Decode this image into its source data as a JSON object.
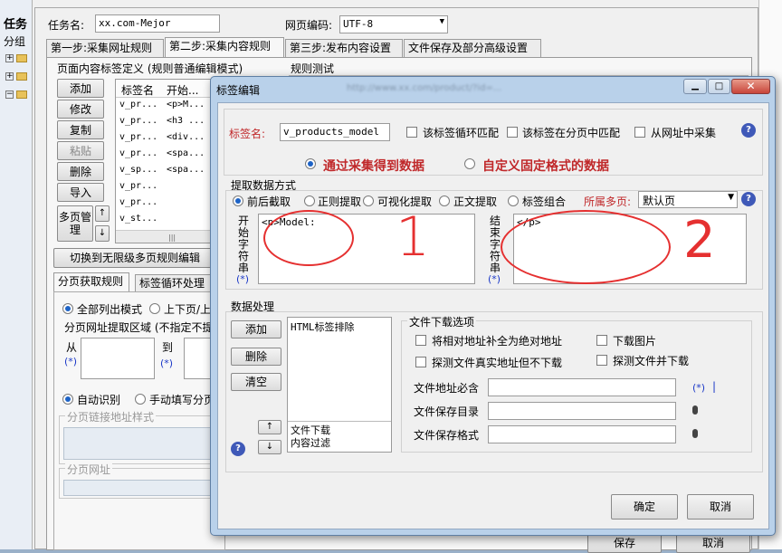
{
  "back": {
    "left_panel_title": "任务",
    "left_panel_group": "分组",
    "task_label": "任务名:",
    "task_value": "xx.com-Mejor",
    "encoding_label": "网页编码:",
    "encoding_value": "UTF-8",
    "tabs": [
      "第一步:采集网址规则",
      "第二步:采集内容规则",
      "第三步:发布内容设置",
      "文件保存及部分高级设置"
    ],
    "def_title": "页面内容标签定义 (规则普通编辑模式)",
    "test_title": "规则测试",
    "buttons": [
      "添加",
      "修改",
      "复制",
      "粘贴",
      "删除",
      "导入"
    ],
    "multipage_btn": "多页管理",
    "col_name": "标签名",
    "col_start": "开始...",
    "rows": [
      {
        "name": "v_pr...",
        "start": "<p>M..."
      },
      {
        "name": "v_pr...",
        "start": "<h3 ..."
      },
      {
        "name": "v_pr...",
        "start": "<div..."
      },
      {
        "name": "v_pr...",
        "start": "<spa..."
      },
      {
        "name": "v_sp...",
        "start": "<spa..."
      },
      {
        "name": "v_pr...",
        "start": ""
      },
      {
        "name": "v_pr...",
        "start": ""
      },
      {
        "name": "v_st...",
        "start": ""
      }
    ],
    "switch_btn": "切换到无限级多页规则编辑",
    "sub_tabs": [
      "分页获取规则",
      "标签循环处理"
    ],
    "list_all": "全部列出模式",
    "updown": "上下页/上",
    "page_area": "分页网址提取区域 (不指定不提",
    "from": "从",
    "to": "到",
    "star": "(*)",
    "auto": "自动识别",
    "manual": "手动填写分页",
    "link_style": "分页链接地址样式",
    "page_url": "分页网址",
    "save_btn": "保存",
    "cancel_btn": "取消"
  },
  "dialog": {
    "title": "标签编辑",
    "blurred_url": "http://www.xx.com/product/?id=...",
    "tag_name_label": "标签名:",
    "tag_name_value": "v_products_model",
    "chk_loop": "该标签循环匹配",
    "chk_paging": "该标签在分页中匹配",
    "chk_url": "从网址中采集",
    "opt_collect": "通过采集得到数据",
    "opt_custom": "自定义固定格式的数据",
    "extract_title": "提取数据方式",
    "methods": [
      "前后截取",
      "正则提取",
      "可视化提取",
      "正文提取",
      "标签组合"
    ],
    "belong_label": "所属多页:",
    "belong_value": "默认页",
    "start_label": "开始字符串",
    "start_value": "<p>Model:",
    "end_label": "结束字符串",
    "end_value": "</p>",
    "star": "(*)",
    "annotation_1": "1",
    "annotation_2": "2",
    "proc_title": "数据处理",
    "proc_add": "添加",
    "proc_del": "删除",
    "proc_clear": "清空",
    "proc_list": [
      "HTML标签排除"
    ],
    "proc_list_bottom": [
      "文件下载",
      "内容过滤"
    ],
    "dl_title": "文件下载选项",
    "dl_abs": "将相对地址补全为绝对地址",
    "dl_img": "下载图片",
    "dl_probe_no": "探测文件真实地址但不下载",
    "dl_probe_yes": "探测文件并下载",
    "dl_must": "文件地址必含",
    "dl_dir": "文件保存目录",
    "dl_fmt": "文件保存格式",
    "ok": "确定",
    "cancel": "取消"
  },
  "colors": {
    "accent": "#1d63c6",
    "red_label": "#c0282a",
    "annotation": "#e53030"
  }
}
